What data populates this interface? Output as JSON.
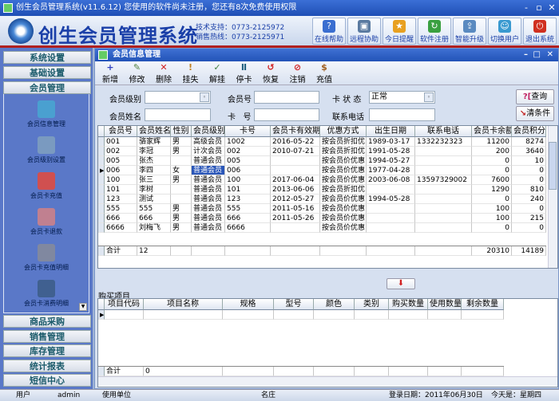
{
  "window": {
    "title": "创生会员管理系统(v11.6.12)   您使用的软件尚未注册，您还有8次免费使用权限",
    "min": "-",
    "restore": "▫",
    "close": "✕"
  },
  "header": {
    "brand": "创生会员管理系统",
    "tech_support": "技术支持：0773-2125972",
    "sales_hotline": "销售热线：0773-2125971",
    "buttons": [
      {
        "label": "在线帮助",
        "icon": "?",
        "color": "#3a6ed0"
      },
      {
        "label": "远程协助",
        "icon": "▣",
        "color": "#5a7aa0"
      },
      {
        "label": "今日提醒",
        "icon": "★",
        "color": "#e8a020"
      },
      {
        "label": "软件注册",
        "icon": "↻",
        "color": "#3aa040"
      },
      {
        "label": "智能升级",
        "icon": "⇪",
        "color": "#5a8ac0"
      },
      {
        "label": "切换用户",
        "icon": "☺",
        "color": "#3a9ad0"
      },
      {
        "label": "退出系统",
        "icon": "⏻",
        "color": "#d03020"
      }
    ]
  },
  "sidebar": {
    "sections_top": [
      "系统设置",
      "基础设置",
      "会员管理"
    ],
    "items": [
      {
        "label": "会员信息管理",
        "color": "#4aa0d0"
      },
      {
        "label": "会员级别设置",
        "color": "#7a9ac0"
      },
      {
        "label": "会员卡充值",
        "color": "#d05050"
      },
      {
        "label": "会员卡退款",
        "color": "#c08090"
      },
      {
        "label": "会员卡充值明细",
        "color": "#8088a0"
      },
      {
        "label": "会员卡消费明细",
        "color": "#406090"
      }
    ],
    "sections_bottom": [
      "商品采购",
      "销售管理",
      "库存管理",
      "统计报表",
      "短信中心"
    ]
  },
  "member_window": {
    "title": "会员信息管理",
    "toolbar": [
      {
        "label": "新增",
        "icon": "+",
        "color": "#3040c0"
      },
      {
        "label": "修改",
        "icon": "✎",
        "color": "#508040"
      },
      {
        "label": "删除",
        "icon": "✕",
        "color": "#d02020"
      },
      {
        "label": "挂失",
        "icon": "!",
        "color": "#c08020"
      },
      {
        "label": "解挂",
        "icon": "✓",
        "color": "#408040"
      },
      {
        "label": "停卡",
        "icon": "Ⅱ",
        "color": "#206080"
      },
      {
        "label": "恢复",
        "icon": "↺",
        "color": "#d02020"
      },
      {
        "label": "注销",
        "icon": "⊘",
        "color": "#d02020"
      },
      {
        "label": "充值",
        "icon": "$",
        "color": "#a06020"
      }
    ],
    "filters": {
      "level_label": "会员级别",
      "level_value": "",
      "member_no_label": "会员号",
      "member_no_value": "",
      "card_status_label": "卡 状 态",
      "card_status_value": "正常",
      "name_label": "会员姓名",
      "name_value": "",
      "card_no_label": "卡   号",
      "card_no_value": "",
      "phone_label": "联系电话",
      "phone_value": "",
      "query_button": "查询",
      "clear_button": "清条件"
    },
    "grid": {
      "columns": [
        "会员号",
        "会员姓名",
        "性别",
        "会员级别",
        "卡号",
        "会员卡有效期",
        "优惠方式",
        "出生日期",
        "联系电话",
        "会员卡余额",
        "会员积分"
      ],
      "rows": [
        [
          "001",
          "骆家辉",
          "男",
          "高级会员",
          "1002",
          "2016-05-22",
          "按会员折扣优",
          "1989-03-17",
          "1332232323",
          "11200",
          "8274"
        ],
        [
          "002",
          "李冠",
          "男",
          "计次会员",
          "002",
          "2010-07-21",
          "按会员折扣优",
          "1991-05-28",
          "",
          "200",
          "3640"
        ],
        [
          "005",
          "张杰",
          "",
          "普通会员",
          "005",
          "",
          "按会员价优惠",
          "1994-05-27",
          "",
          "0",
          "10"
        ],
        [
          "006",
          "李四",
          "女",
          "普通会员",
          "006",
          "",
          "按会员价优惠",
          "1977-04-28",
          "",
          "0",
          "0"
        ],
        [
          "100",
          "张三",
          "男",
          "普通会员",
          "100",
          "2017-06-04",
          "按会员价优惠",
          "2003-06-08",
          "13597329002",
          "7600",
          "0"
        ],
        [
          "101",
          "李树",
          "",
          "普通会员",
          "101",
          "2013-06-06",
          "按会员折扣优",
          "",
          "",
          "1290",
          "810"
        ],
        [
          "123",
          "测试",
          "",
          "普通会员",
          "123",
          "2012-05-27",
          "按会员价优惠",
          "1994-05-28",
          "",
          "0",
          "240"
        ],
        [
          "555",
          "555",
          "男",
          "普通会员",
          "555",
          "2011-05-16",
          "按会员价优惠",
          "",
          "",
          "100",
          "0"
        ],
        [
          "666",
          "666",
          "男",
          "普通会员",
          "666",
          "2011-05-26",
          "按会员价优惠",
          "",
          "",
          "100",
          "215"
        ],
        [
          "6666",
          "刘梅飞",
          "男",
          "普通会员",
          "6666",
          "",
          "按会员价优惠",
          "",
          "",
          "0",
          "0"
        ]
      ],
      "selected_row": 3,
      "totals": {
        "label": "合计",
        "count": "12",
        "balance": "20310",
        "points": "14189"
      }
    },
    "purchase": {
      "title": "购买项目",
      "columns": [
        "项目代码",
        "项目名称",
        "规格",
        "型号",
        "颜色",
        "类别",
        "购买数量",
        "使用数量",
        "剩余数量"
      ],
      "totals": {
        "label": "合计",
        "value": "0"
      }
    }
  },
  "statusbar": {
    "user_label": "用户",
    "user": "admin",
    "unit_label": "使用单位",
    "unit": "名庄",
    "login_date": "登录日期：2011年06月30日",
    "today": "今天是：星期四"
  }
}
